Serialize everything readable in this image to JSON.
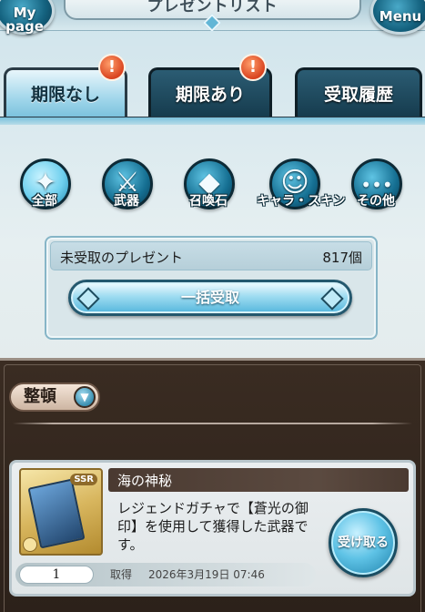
{
  "header": {
    "title": "プレゼントリスト",
    "mypage_label_line1": "My",
    "mypage_label_line2": "page",
    "menu_label": "Menu"
  },
  "tabs": [
    {
      "label": "期限なし",
      "active": true,
      "badge": "!"
    },
    {
      "label": "期限あり",
      "active": false,
      "badge": "!"
    },
    {
      "label": "受取履歴",
      "active": false,
      "badge": ""
    }
  ],
  "categories": [
    {
      "label": "全部",
      "icon": "all-items-icon",
      "glyph": "✦",
      "active": true
    },
    {
      "label": "武器",
      "icon": "sword-icon",
      "glyph": "⚔",
      "active": false
    },
    {
      "label": "召喚石",
      "icon": "summon-stone-icon",
      "glyph": "◆",
      "active": false
    },
    {
      "label": "キャラ・スキン",
      "icon": "character-icon",
      "glyph": "☺",
      "active": false
    },
    {
      "label": "その他",
      "icon": "more-icon",
      "glyph": "•••",
      "active": false
    }
  ],
  "bulk": {
    "unreceived_label": "未受取のプレゼント",
    "count": "817個",
    "button_label": "一括受取"
  },
  "sort": {
    "label": "整頓",
    "icon": "chevron-down-icon"
  },
  "item": {
    "title": "海の神秘",
    "description": "レジェンドガチャで【蒼光の御印】を使用して獲得した武器です。",
    "rarity": "SSR",
    "quantity": "1",
    "acquired_label": "取得",
    "acquired_date": "2026年3月19日 07:46",
    "receive_button_label": "受け取る"
  },
  "colors": {
    "accent_blue": "#53b6dc",
    "dark_panel": "#2c211a",
    "badge_orange": "#d9431f"
  }
}
